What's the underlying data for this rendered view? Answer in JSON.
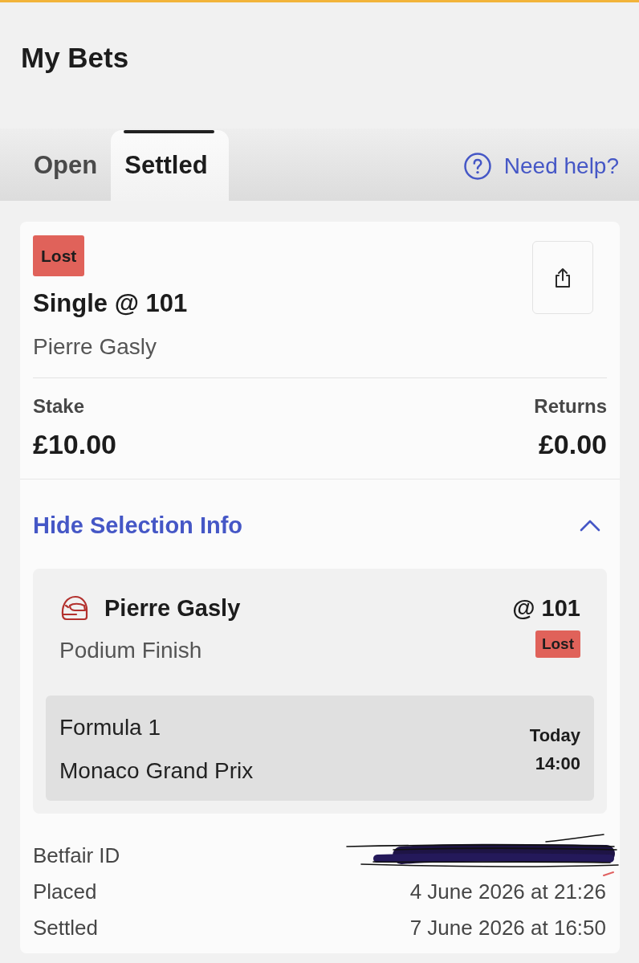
{
  "header": {
    "title": "My Bets"
  },
  "tabs": [
    {
      "label": "Open",
      "selected": false
    },
    {
      "label": "Settled",
      "selected": true
    }
  ],
  "help_link": {
    "label": "Need help?"
  },
  "bet": {
    "status": {
      "label": "Lost",
      "kind": "lost"
    },
    "title": "Single @ 101",
    "selection_name": "Pierre Gasly",
    "stake": {
      "label": "Stake",
      "value": "£10.00"
    },
    "returns": {
      "label": "Returns",
      "value": "£0.00"
    },
    "selection_info": {
      "toggle_label": "Hide Selection Info",
      "expanded": true,
      "selection": {
        "name": "Pierre Gasly",
        "odds": "@ 101",
        "market": "Podium Finish",
        "status": {
          "label": "Lost",
          "kind": "lost"
        },
        "event": {
          "competition": "Formula 1",
          "name": "Monaco Grand Prix",
          "day": "Today",
          "time": "14:00"
        }
      }
    },
    "details": [
      {
        "label": "Betfair ID",
        "redacted": true
      },
      {
        "label": "Placed",
        "value": "4 June 2026 at 21:26",
        "redacted": false
      },
      {
        "label": "Settled",
        "value": "7 June 2026 at 16:50",
        "redacted": false
      }
    ]
  }
}
